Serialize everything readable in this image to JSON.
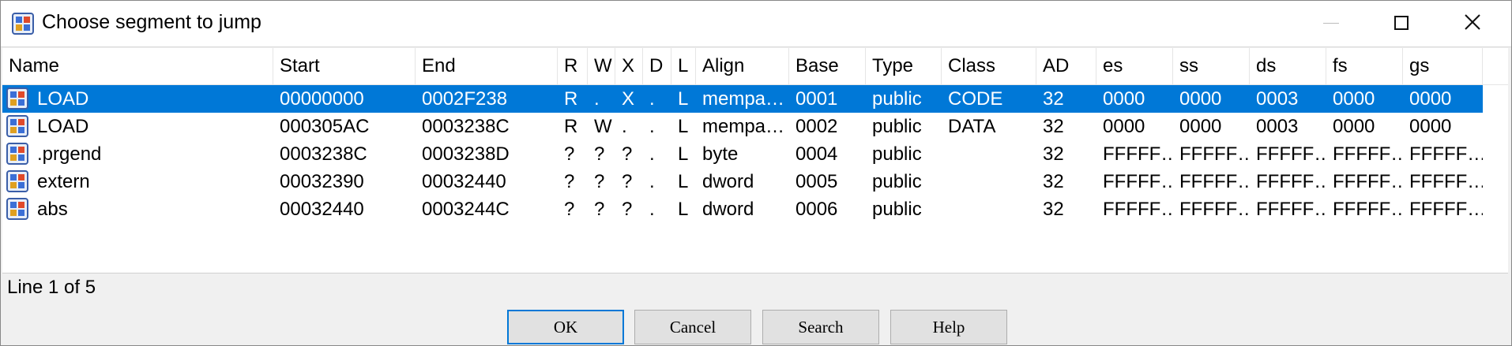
{
  "window": {
    "title": "Choose segment to jump"
  },
  "columns": [
    "Name",
    "Start",
    "End",
    "R",
    "W",
    "X",
    "D",
    "L",
    "Align",
    "Base",
    "Type",
    "Class",
    "AD",
    "es",
    "ss",
    "ds",
    "fs",
    "gs"
  ],
  "rows": [
    {
      "name": "LOAD",
      "start": "00000000",
      "end": "0002F238",
      "r": "R",
      "w": ".",
      "x": "X",
      "d": ".",
      "l": "L",
      "align": "mempa…",
      "base": "0001",
      "type": "public",
      "class": "CODE",
      "ad": "32",
      "es": "0000",
      "ss": "0000",
      "ds": "0003",
      "fs": "0000",
      "gs": "0000"
    },
    {
      "name": "LOAD",
      "start": "000305AC",
      "end": "0003238C",
      "r": "R",
      "w": "W",
      "x": ".",
      "d": ".",
      "l": "L",
      "align": "mempa…",
      "base": "0002",
      "type": "public",
      "class": "DATA",
      "ad": "32",
      "es": "0000",
      "ss": "0000",
      "ds": "0003",
      "fs": "0000",
      "gs": "0000"
    },
    {
      "name": ".prgend",
      "start": "0003238C",
      "end": "0003238D",
      "r": "?",
      "w": "?",
      "x": "?",
      "d": ".",
      "l": "L",
      "align": "byte",
      "base": "0004",
      "type": "public",
      "class": "",
      "ad": "32",
      "es": "FFFFF…",
      "ss": "FFFFF…",
      "ds": "FFFFF…",
      "fs": "FFFFF…",
      "gs": "FFFFF…"
    },
    {
      "name": "extern",
      "start": "00032390",
      "end": "00032440",
      "r": "?",
      "w": "?",
      "x": "?",
      "d": ".",
      "l": "L",
      "align": "dword",
      "base": "0005",
      "type": "public",
      "class": "",
      "ad": "32",
      "es": "FFFFF…",
      "ss": "FFFFF…",
      "ds": "FFFFF…",
      "fs": "FFFFF…",
      "gs": "FFFFF…"
    },
    {
      "name": "abs",
      "start": "00032440",
      "end": "0003244C",
      "r": "?",
      "w": "?",
      "x": "?",
      "d": ".",
      "l": "L",
      "align": "dword",
      "base": "0006",
      "type": "public",
      "class": "",
      "ad": "32",
      "es": "FFFFF…",
      "ss": "FFFFF…",
      "ds": "FFFFF…",
      "fs": "FFFFF…",
      "gs": "FFFFF…"
    }
  ],
  "selected_row": 0,
  "status": "Line 1 of 5",
  "buttons": {
    "ok": "OK",
    "cancel": "Cancel",
    "search": "Search",
    "help": "Help"
  },
  "icons": {
    "app": "segment-app-icon",
    "row": "segment-icon",
    "minimize": "minimize-icon",
    "maximize": "maximize-icon",
    "close": "close-icon"
  },
  "colors": {
    "selection": "#0078d7",
    "default_button_border": "#0078d7"
  }
}
